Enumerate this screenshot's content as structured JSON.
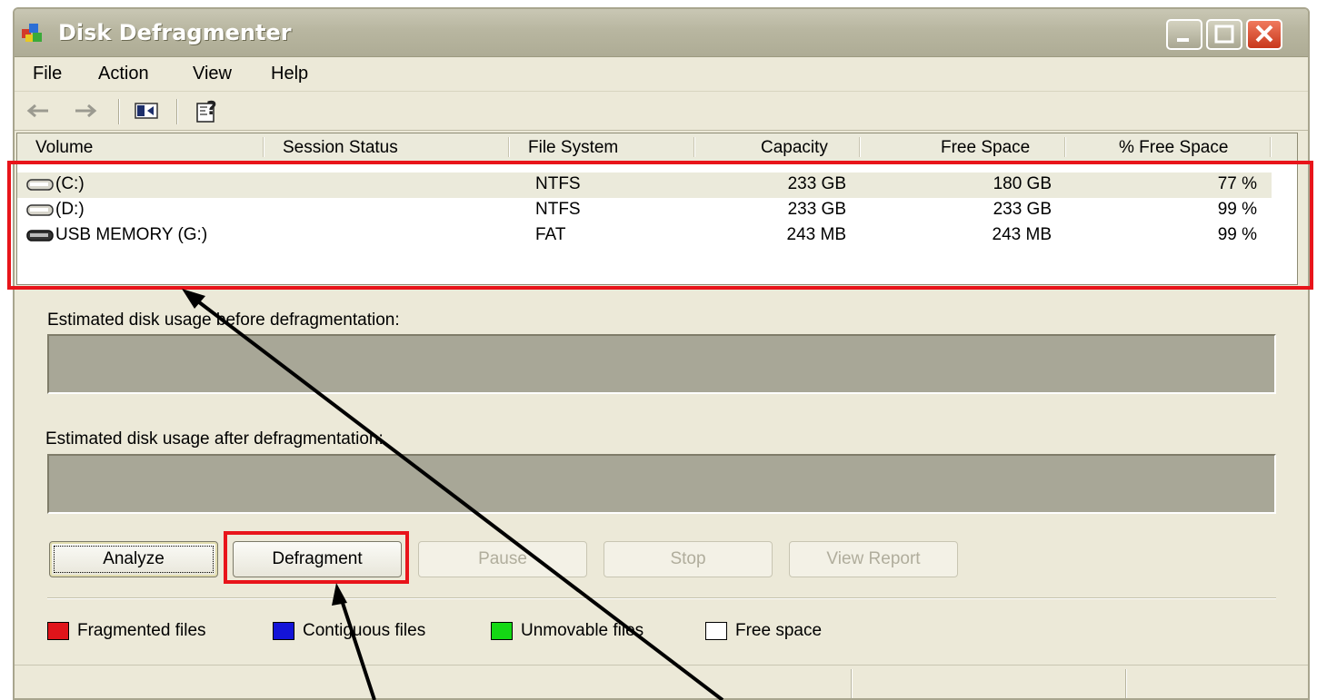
{
  "window": {
    "title": "Disk Defragmenter",
    "controls": {
      "minimize": "minimize",
      "maximize": "maximize",
      "close": "close"
    }
  },
  "menu": [
    {
      "label": "File"
    },
    {
      "label": "Action"
    },
    {
      "label": "View"
    },
    {
      "label": "Help"
    }
  ],
  "toolbar": {
    "icons": [
      "back-arrow-icon",
      "forward-arrow-icon",
      "show-hide-console-tree-icon",
      "help-icon"
    ]
  },
  "volume_list": {
    "columns": [
      "Volume",
      "Session Status",
      "File System",
      "Capacity",
      "Free Space",
      "% Free Space"
    ],
    "rows": [
      {
        "volume": "(C:)",
        "session_status": "",
        "file_system": "NTFS",
        "capacity": "233 GB",
        "free_space": "180 GB",
        "pct_free": "77 %"
      },
      {
        "volume": "(D:)",
        "session_status": "",
        "file_system": "NTFS",
        "capacity": "233 GB",
        "free_space": "233 GB",
        "pct_free": "99 %"
      },
      {
        "volume": "USB MEMORY (G:)",
        "session_status": "",
        "file_system": "FAT",
        "capacity": "243 MB",
        "free_space": "243 MB",
        "pct_free": "99 %"
      }
    ]
  },
  "usage": {
    "before_label": "Estimated disk usage before defragmentation:",
    "after_label": "Estimated disk usage after defragmentation:"
  },
  "buttons": {
    "analyze": "Analyze",
    "defragment": "Defragment",
    "pause": "Pause",
    "stop": "Stop",
    "view_report": "View Report"
  },
  "legend": [
    {
      "label": "Fragmented files",
      "color": "#e0141a"
    },
    {
      "label": "Contiguous files",
      "color": "#1414d8"
    },
    {
      "label": "Unmovable files",
      "color": "#14d814"
    },
    {
      "label": "Free space",
      "color": "#ffffff"
    }
  ],
  "annotation_color": "#e8141a"
}
